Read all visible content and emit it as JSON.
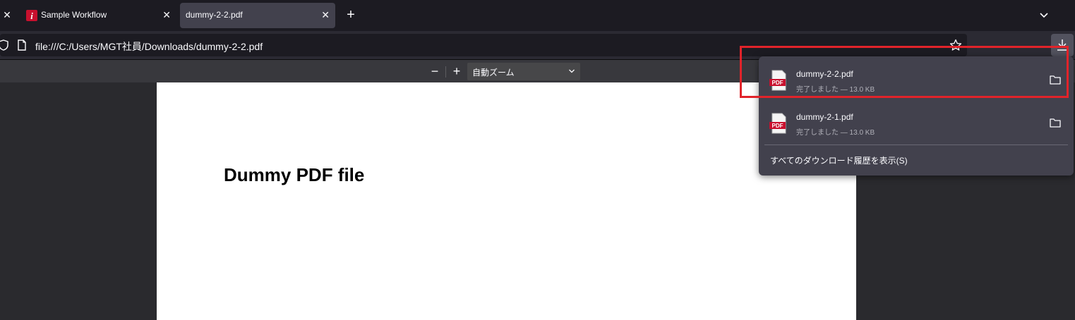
{
  "tabs": [
    {
      "label": "Sample Workflow"
    },
    {
      "label": "dummy-2-2.pdf"
    }
  ],
  "urlbar": {
    "url": "file:///C:/Users/MGT社員/Downloads/dummy-2-2.pdf"
  },
  "pdf_toolbar": {
    "zoom_out": "−",
    "zoom_in": "+",
    "zoom_value": "自動ズーム"
  },
  "pdf_page": {
    "title": "Dummy PDF file"
  },
  "downloads": {
    "items": [
      {
        "name": "dummy-2-2.pdf",
        "status": "完了しました — 13.0 KB",
        "icon_text": "PDF"
      },
      {
        "name": "dummy-2-1.pdf",
        "status": "完了しました — 13.0 KB",
        "icon_text": "PDF"
      }
    ],
    "show_all": "すべてのダウンロード履歴を表示(S)"
  },
  "colors": {
    "highlight": "#e1232a",
    "tab_active": "#42414d",
    "panel": "#42414d"
  }
}
